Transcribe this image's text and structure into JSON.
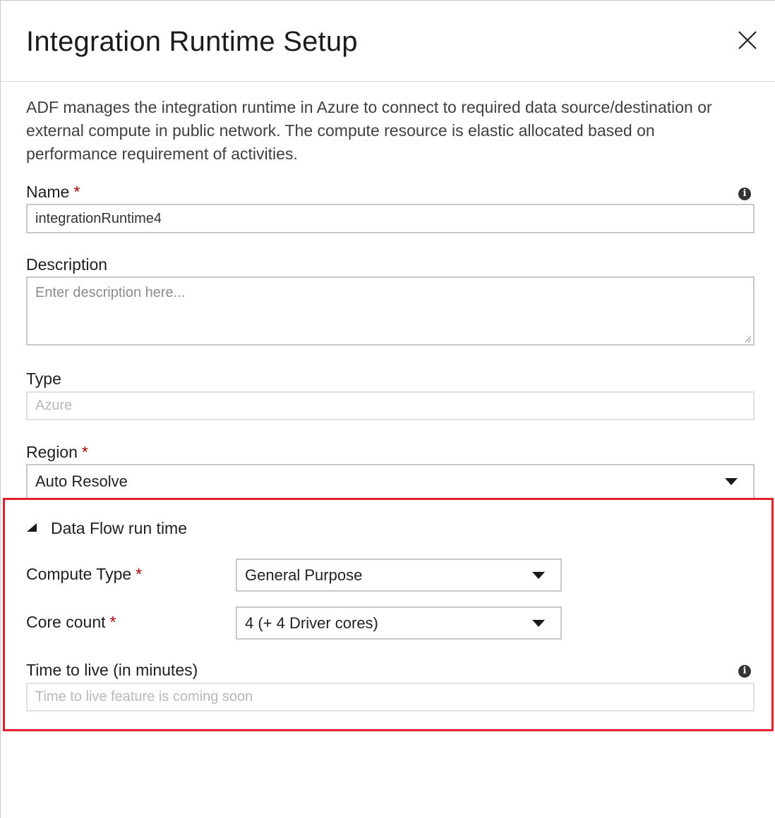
{
  "header": {
    "title": "Integration Runtime Setup",
    "close_icon": "close-icon"
  },
  "description": "ADF manages the integration runtime in Azure to connect to required data source/destination or external compute in public network. The compute resource is elastic allocated based on performance requirement of activities.",
  "fields": {
    "name": {
      "label": "Name",
      "required_mark": "*",
      "value": "integrationRuntime4",
      "info_icon": "info-icon"
    },
    "description": {
      "label": "Description",
      "placeholder": "Enter description here..."
    },
    "type": {
      "label": "Type",
      "value": "Azure"
    },
    "region": {
      "label": "Region",
      "required_mark": "*",
      "value": "Auto Resolve"
    }
  },
  "data_flow": {
    "section_title": "Data Flow run time",
    "compute_type": {
      "label": "Compute Type",
      "required_mark": "*",
      "value": "General Purpose"
    },
    "core_count": {
      "label": "Core count",
      "required_mark": "*",
      "value": "4 (+ 4 Driver cores)"
    },
    "time_to_live": {
      "label": "Time to live (in minutes)",
      "placeholder": "Time to live feature is coming soon",
      "info_icon": "info-icon"
    }
  },
  "colors": {
    "highlight_border": "#e0202e",
    "required_star": "#a80000"
  }
}
